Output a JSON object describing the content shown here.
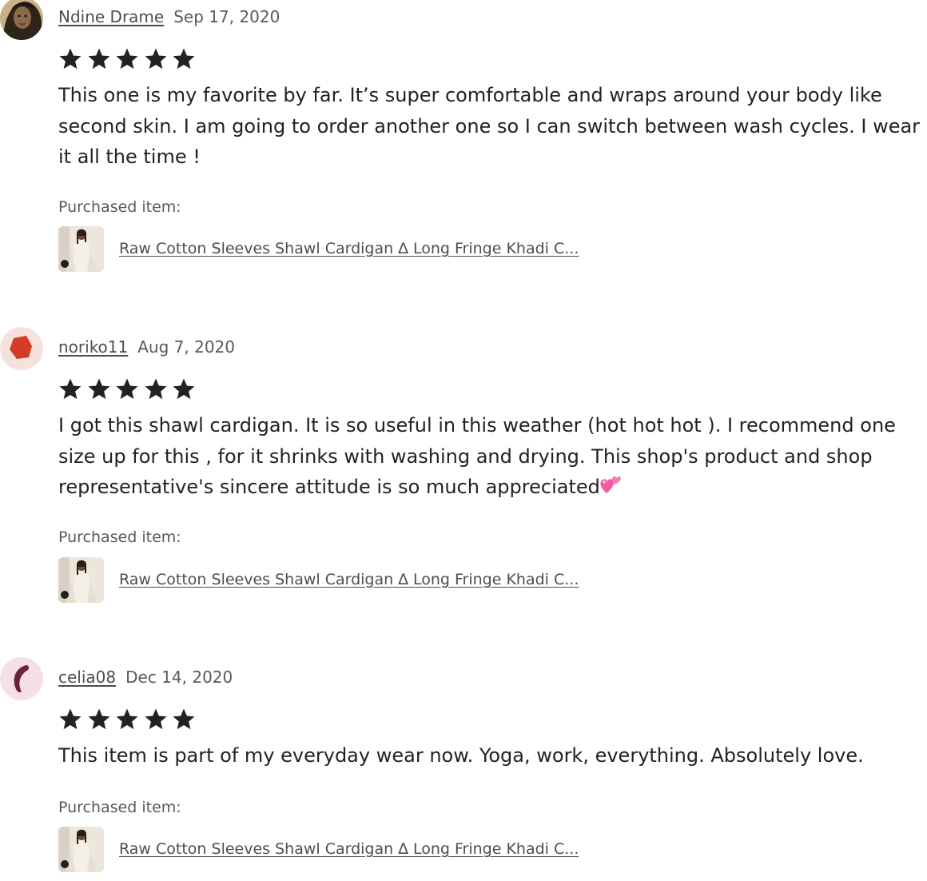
{
  "reviews": [
    {
      "reviewer": "Ndine Drame",
      "date": "Sep 17, 2020",
      "rating": 5,
      "text": "This one is my favorite by far. It’s super comfortable and wraps around your body like second skin. I am going to order another one so I can switch between wash cycles. I wear it all the time !",
      "purchased_label": "Purchased item:",
      "product_title": "Raw Cotton Sleeves Shawl Cardigan ∆ Long Fringe Khadi C...",
      "avatar_icon": "photo-avatar"
    },
    {
      "reviewer": "noriko11",
      "date": "Aug 7, 2020",
      "rating": 5,
      "text": "I got this shawl cardigan. It is so useful in this weather (hot hot hot ). I recommend one size up for this , for it shrinks with washing and drying. This shop's product and shop representative's sincere attitude is so much appreciated",
      "emoji": "two-hearts-emoji",
      "purchased_label": "Purchased item:",
      "product_title": "Raw Cotton Sleeves Shawl Cardigan ∆ Long Fringe Khadi C...",
      "avatar_icon": "red-hexagon-avatar",
      "avatar_color": "#d43c25",
      "avatar_bg": "#f6e2dc"
    },
    {
      "reviewer": "celia08",
      "date": "Dec 14, 2020",
      "rating": 5,
      "text": "This item is part of my everyday wear now. Yoga, work, everything. Absolutely love.",
      "purchased_label": "Purchased item:",
      "product_title": "Raw Cotton Sleeves Shawl Cardigan ∆ Long Fringe Khadi C...",
      "avatar_icon": "purple-crescent-avatar",
      "avatar_color": "#6b2140",
      "avatar_bg": "#f7dfe8"
    }
  ],
  "colors": {
    "star": "#222222",
    "text": "#222222",
    "muted": "#595959",
    "link": "#4d4d4d"
  },
  "icons": {
    "star": "star-icon",
    "product_thumbnail": "product-thumbnail"
  }
}
